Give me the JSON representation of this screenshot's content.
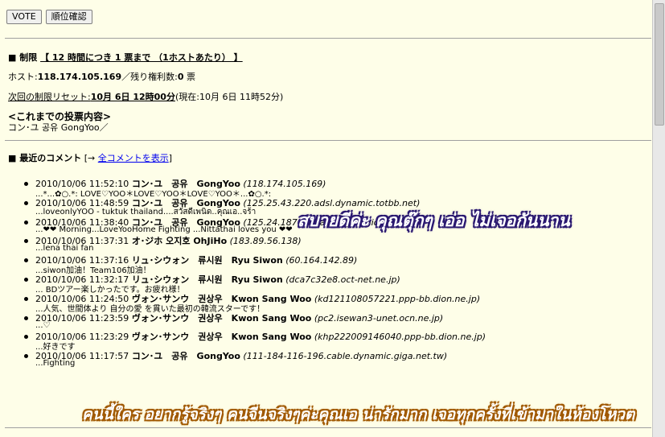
{
  "buttons": {
    "vote": "VOTE",
    "rank": "順位確認"
  },
  "limit": {
    "label": "■ 制限",
    "rule": "【 12 時間につき 1 票まで （1ホストあたり） 】"
  },
  "host_line": {
    "host_label": "ホスト:",
    "host_value": "118.174.105.169",
    "sep": "／残り権利数:",
    "remaining": "0",
    "unit": " 票"
  },
  "reset_line": {
    "label": "次回の制限リセット:",
    "value": "10月 6日 12時00分",
    "now": "(現在:10月 6日 11時52分)"
  },
  "history": {
    "title": "<これまでの投票内容>",
    "content": "コン･ユ 공유 GongYoo／"
  },
  "recent": {
    "label": "■ 最近のコメント",
    "bracket_open": "[→ ",
    "link": "全コメントを表示",
    "bracket_close": "]"
  },
  "comments": [
    {
      "datetime": "2010/10/06 11:52:10",
      "name": "コン･ユ　공유　GongYoo",
      "host": "(118.174.105.169)",
      "text": "...*...✿○.*: LOVE♡YOO＊LOVE♡YOO＊LOVE♡YOO＊...✿○.*:"
    },
    {
      "datetime": "2010/10/06 11:48:59",
      "name": "コン･ユ　공유　GongYoo",
      "host": "(125.25.43.220.adsl.dynamic.totbb.net)",
      "text": "...loveonlyYOO - tuktuk thailand....สวัสดีเพนิด..คุณเอ..จร้า"
    },
    {
      "datetime": "2010/10/06 11:38:40",
      "name": "コン･ユ　공유　GongYoo",
      "host": "(125.24.187.156.adsl.dynamic.totbb.net)",
      "text": "...❤❤ Morning...LoveYooHome Fighting ...Nittathai loves you ❤❤"
    },
    {
      "datetime": "2010/10/06 11:37:31",
      "name": "オ･ジホ 오지호 OhJiHo",
      "host": "(183.89.56.138)",
      "text": "...lena thai fan"
    },
    {
      "datetime": "2010/10/06 11:37:16",
      "name": "リュ･シウォン　류시원　Ryu Siwon",
      "host": "(60.164.142.89)",
      "text": "...siwon加油！Team106加油！"
    },
    {
      "datetime": "2010/10/06 11:32:17",
      "name": "リュ･シウォン　류시원　Ryu Siwon",
      "host": "(dca7c32e8.oct-net.ne.jp)",
      "text": "... BDツアー楽しかったです。お疲れ様！"
    },
    {
      "datetime": "2010/10/06 11:24:50",
      "name": "ヴォン･サンウ　권상우　Kwon Sang Woo",
      "host": "(kd121108057221.ppp-bb.dion.ne.jp)",
      "text": "...人気、世間体より 自分の愛 を貫いた最初の韓流スターです！"
    },
    {
      "datetime": "2010/10/06 11:23:59",
      "name": "ヴォン･サンウ　권상우　Kwon Sang Woo",
      "host": "(pc2.isewan3-unet.ocn.ne.jp)",
      "text": "...♡"
    },
    {
      "datetime": "2010/10/06 11:23:29",
      "name": "ヴォン･サンウ　권상우　Kwon Sang Woo",
      "host": "(khp222009146040.ppp-bb.dion.ne.jp)",
      "text": "...好きです"
    },
    {
      "datetime": "2010/10/06 11:17:57",
      "name": "コン･ユ　공유　GongYoo",
      "host": "(111-184-116-196.cable.dynamic.giga.net.tw)",
      "text": "...Fighting"
    }
  ],
  "overlay_top": "สบายดีค่ะ คุณตุ๊กๆ เอ่อ ไม่เจอกันนาน",
  "overlay_bottom": "คนนี้ใคร อยากรู้จริงๆ คนจีนจริงๆค่ะคุณเอ น่ารักมาก เจอทุกครั้งที่เข้ามาในห้องโหวต"
}
